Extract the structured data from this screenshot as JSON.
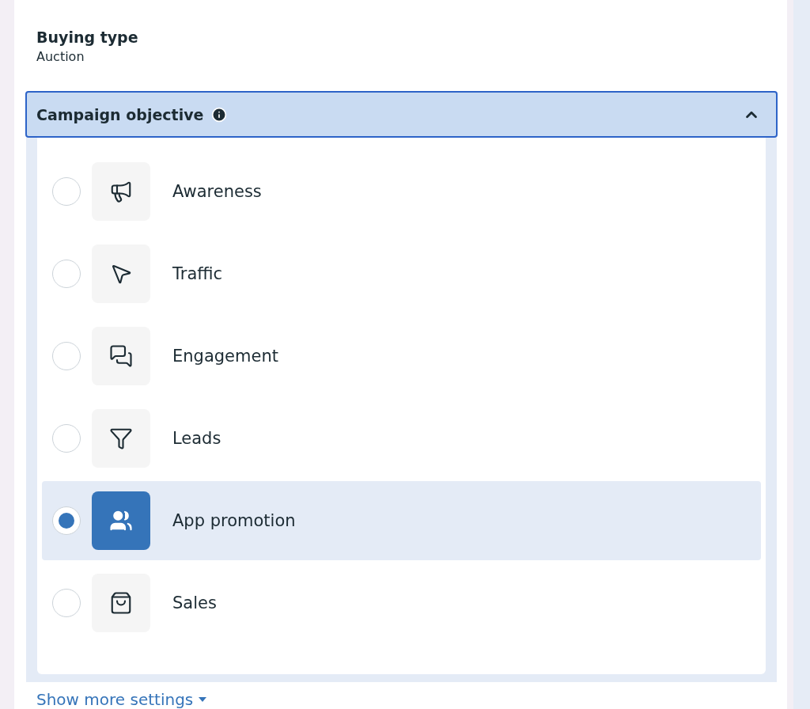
{
  "buying_type": {
    "label": "Buying type",
    "value": "Auction"
  },
  "campaign_objective": {
    "title": "Campaign objective",
    "expanded": true,
    "options": [
      {
        "label": "Awareness",
        "selected": false
      },
      {
        "label": "Traffic",
        "selected": false
      },
      {
        "label": "Engagement",
        "selected": false
      },
      {
        "label": "Leads",
        "selected": false
      },
      {
        "label": "App promotion",
        "selected": true
      },
      {
        "label": "Sales",
        "selected": false
      }
    ]
  },
  "show_more_link": "Show more settings"
}
